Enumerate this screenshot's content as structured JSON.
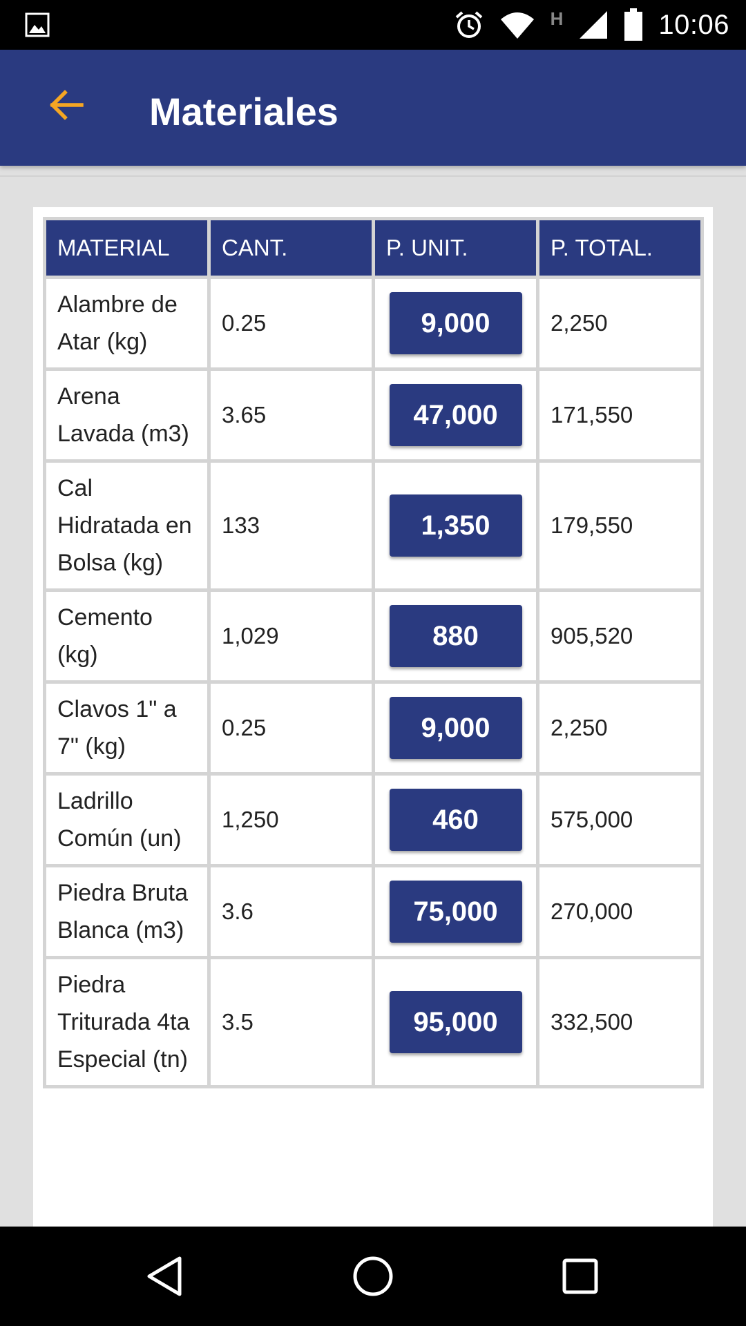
{
  "status_bar": {
    "time": "10:06",
    "network_label": "H",
    "icons": [
      "image-icon",
      "alarm-icon",
      "wifi-icon",
      "signal-icon",
      "battery-icon"
    ]
  },
  "app_bar": {
    "title": "Materiales",
    "back_icon": "arrow-back-icon",
    "back_color": "#f5a623"
  },
  "colors": {
    "primary": "#2a3a80",
    "accent": "#f5a623"
  },
  "table": {
    "headers": {
      "material": "MATERIAL",
      "qty": "CANT.",
      "unit": "P. UNIT.",
      "total": "P. TOTAL."
    },
    "rows": [
      {
        "material": "Alambre de Atar (kg)",
        "qty": "0.25",
        "unit": "9,000",
        "total": "2,250"
      },
      {
        "material": "Arena Lavada (m3)",
        "qty": "3.65",
        "unit": "47,000",
        "total": "171,550"
      },
      {
        "material": "Cal Hidratada en Bolsa (kg)",
        "qty": "133",
        "unit": "1,350",
        "total": "179,550"
      },
      {
        "material": "Cemento (kg)",
        "qty": "1,029",
        "unit": "880",
        "total": "905,520"
      },
      {
        "material": "Clavos 1\" a 7\" (kg)",
        "qty": "0.25",
        "unit": "9,000",
        "total": "2,250"
      },
      {
        "material": "Ladrillo Común (un)",
        "qty": "1,250",
        "unit": "460",
        "total": "575,000"
      },
      {
        "material": "Piedra Bruta Blanca (m3)",
        "qty": "3.6",
        "unit": "75,000",
        "total": "270,000"
      },
      {
        "material": "Piedra Triturada 4ta Especial (tn)",
        "qty": "3.5",
        "unit": "95,000",
        "total": "332,500"
      }
    ]
  },
  "nav_bar": {
    "icons": [
      "back-triangle-icon",
      "home-circle-icon",
      "recents-square-icon"
    ]
  }
}
